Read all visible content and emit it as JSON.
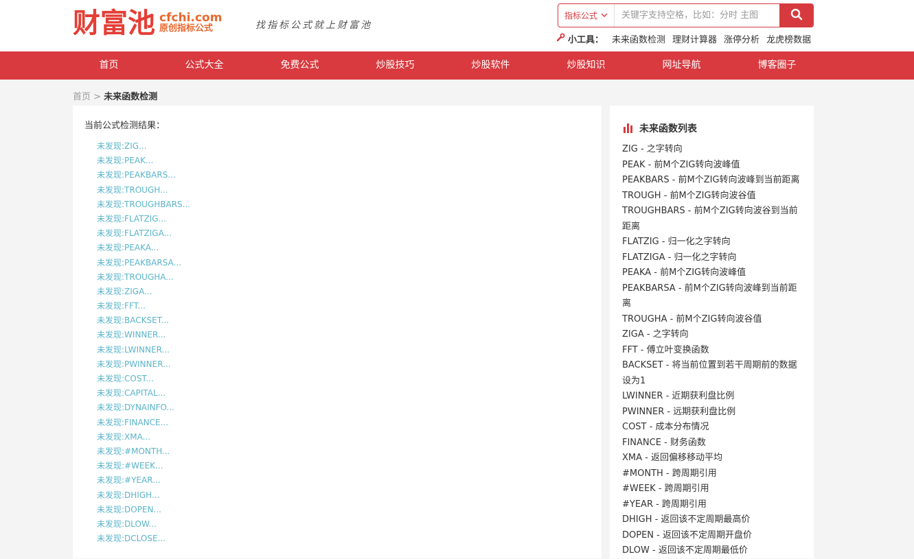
{
  "header": {
    "logo_cn": "财富池",
    "logo_en": "cfchi.com",
    "logo_sub": "原创指标公式",
    "slogan": "找指标公式就上财富池"
  },
  "search": {
    "category": "指标公式",
    "placeholder": "关键字支持空格，比如：分时 主图",
    "button_icon": "search-icon"
  },
  "tools": {
    "label": "小工具：",
    "items": [
      "未来函数检测",
      "理财计算器",
      "涨停分析",
      "龙虎榜数据"
    ]
  },
  "nav": [
    "首页",
    "公式大全",
    "免费公式",
    "炒股技巧",
    "炒股软件",
    "炒股知识",
    "网址导航",
    "博客圈子"
  ],
  "breadcrumb": {
    "home": "首页",
    "sep": ">",
    "current": "未来函数检测"
  },
  "main": {
    "result_title": "当前公式检测结果：",
    "results": [
      "未发现:ZIG...",
      "未发现:PEAK...",
      "未发现:PEAKBARS...",
      "未发现:TROUGH...",
      "未发现:TROUGHBARS...",
      "未发现:FLATZIG...",
      "未发现:FLATZIGA...",
      "未发现:PEAKA...",
      "未发现:PEAKBARSA...",
      "未发现:TROUGHA...",
      "未发现:ZIGA...",
      "未发现:FFT...",
      "未发现:BACKSET...",
      "未发现:WINNER...",
      "未发现:LWINNER...",
      "未发现:PWINNER...",
      "未发现:COST...",
      "未发现:CAPITAL...",
      "未发现:DYNAINFO...",
      "未发现:FINANCE...",
      "未发现:XMA...",
      "未发现:#MONTH...",
      "未发现:#WEEK...",
      "未发现:#YEAR...",
      "未发现:DHIGH...",
      "未发现:DOPEN...",
      "未发现:DLOW...",
      "未发现:DCLOSE..."
    ]
  },
  "side": {
    "title": "未来函数列表",
    "items": [
      "ZIG - 之字转向",
      "PEAK - 前M个ZIG转向波峰值",
      "PEAKBARS - 前M个ZIG转向波峰到当前距离",
      "TROUGH - 前M个ZIG转向波谷值",
      "TROUGHBARS - 前M个ZIG转向波谷到当前距离",
      "FLATZIG - 归一化之字转向",
      "FLATZIGA - 归一化之字转向",
      "PEAKA - 前M个ZIG转向波峰值",
      "PEAKBARSA - 前M个ZIG转向波峰到当前距离",
      "TROUGHA - 前M个ZIG转向波谷值",
      "ZIGA - 之字转向",
      "FFT - 傅立叶变换函数",
      "BACKSET - 将当前位置到若干周期前的数据设为1",
      "LWINNER - 近期获利盘比例",
      "PWINNER - 远期获利盘比例",
      "COST - 成本分布情况",
      "FINANCE - 财务函数",
      "XMA - 返回偏移移动平均",
      "#MONTH - 跨周期引用",
      "#WEEK - 跨周期引用",
      "#YEAR - 跨周期引用",
      "DHIGH - 返回该不定周期最高价",
      "DOPEN - 返回该不定周期开盘价",
      "DLOW - 返回该不定周期最低价"
    ]
  }
}
